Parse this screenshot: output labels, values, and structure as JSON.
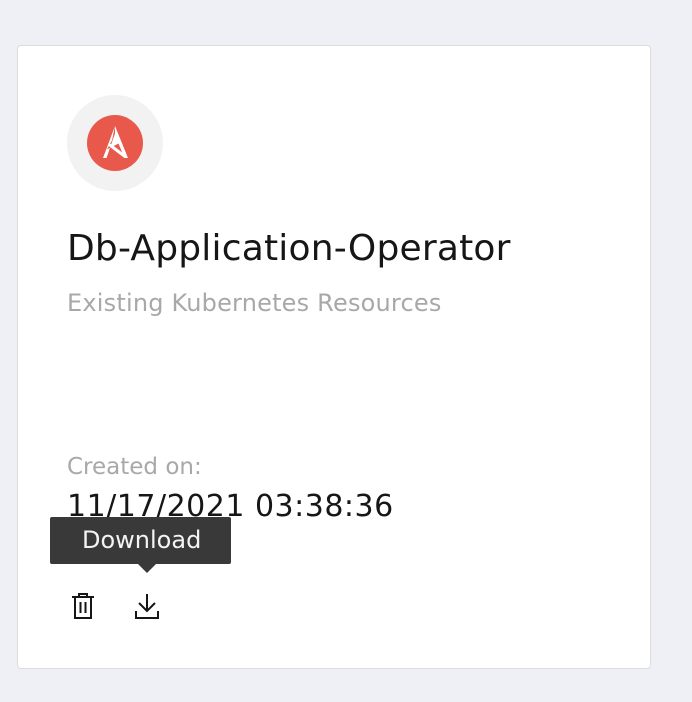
{
  "card": {
    "title": "Db-Application-Operator",
    "subtitle": "Existing Kubernetes Resources",
    "created_label": "Created on:",
    "created_value": "11/17/2021 03:38:36",
    "logo_icon": "ansible-logo-icon",
    "logo_color": "#e8594b"
  },
  "tooltip": {
    "text": "Download"
  },
  "actions": {
    "delete_icon": "trash-icon",
    "download_icon": "download-icon"
  }
}
